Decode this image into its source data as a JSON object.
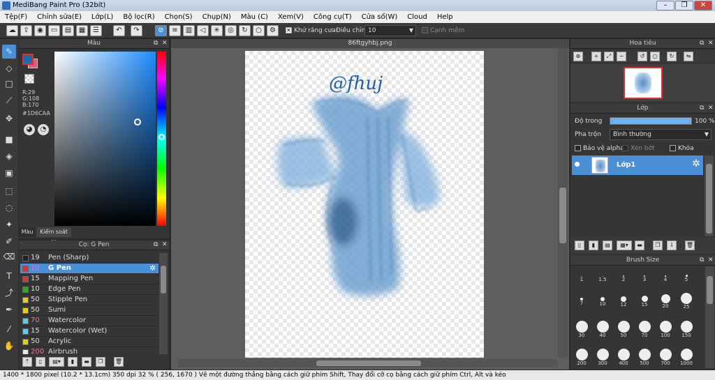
{
  "window": {
    "title": "MediBang Paint Pro (32bit)"
  },
  "menu": [
    "Tệp(F)",
    "Chỉnh sửa(E)",
    "Lớp(L)",
    "Bộ lọc(R)",
    "Chọn(S)",
    "Chụp(N)",
    "Màu (C)",
    "Xem(V)",
    "Công cụ(T)",
    "Cửa sổ(W)",
    "Cloud",
    "Help"
  ],
  "toolbar": {
    "antialias_label": "Khử răng cưa",
    "correction_label": "Điều chỉnh",
    "correction_value": "10",
    "soft_edge_label": "Cạnh mềm"
  },
  "color_panel": {
    "title": "Màu",
    "r": "R:29",
    "g": "G:108",
    "b": "B:170",
    "hex": "#1D6CAA",
    "tab_color": "Màu",
    "tab_brush_control": "Kiểm soát cọ",
    "fg_color": "#1D6CAA",
    "bg_color": "#e05a7a"
  },
  "brush_panel": {
    "title": "Cọ: G Pen",
    "items": [
      {
        "size": "19",
        "name": "Pen (Sharp)",
        "color": "#222222"
      },
      {
        "size": "10",
        "name": "G Pen",
        "color": "#e03030"
      },
      {
        "size": "15",
        "name": "Mapping Pen",
        "color": "#e03030"
      },
      {
        "size": "10",
        "name": "Edge Pen",
        "color": "#20b020"
      },
      {
        "size": "50",
        "name": "Stipple Pen",
        "color": "#e8d000"
      },
      {
        "size": "50",
        "name": "Sumi",
        "color": "#e8d000"
      },
      {
        "size": "70",
        "name": "Watercolor",
        "color": "#60c8f0"
      },
      {
        "size": "15",
        "name": "Watercolor (Wet)",
        "color": "#60c8f0"
      },
      {
        "size": "50",
        "name": "Acrylic",
        "color": "#e8d000"
      },
      {
        "size": "200",
        "name": "Airbrush",
        "color": "#e8e8e8"
      }
    ]
  },
  "canvas": {
    "filename": "86ftgyhbj.png",
    "signature": "@fhuj"
  },
  "navigator": {
    "title": "Hoa tiêu"
  },
  "layer_panel": {
    "title": "Lớp",
    "opacity_label": "Độ trong",
    "opacity_value": "100 %",
    "opacity_fraction": 1.0,
    "blend_label": "Pha trộn",
    "blend_value": "Bình thường",
    "protect_alpha": "Bảo vệ alpha",
    "clipping": "Xén bớt",
    "lock": "Khóa",
    "layer_name": "Lớp1"
  },
  "brush_size_panel": {
    "title": "Brush Size",
    "sizes": [
      "1",
      "1.5",
      "2",
      "3",
      "4",
      "5",
      "7",
      "10",
      "12",
      "15",
      "20",
      "25",
      "30",
      "40",
      "50",
      "70",
      "100",
      "150",
      "200",
      "300",
      "400",
      "500",
      "700",
      "1000"
    ]
  },
  "status": {
    "text": "1400 * 1800 pixel   (10.2 * 13.1cm)   350 dpi   32 %   ( 256, 1670 )   Vẽ một đường thẳng bằng cách giữ phím Shift, Thay đổi cỡ cọ bằng cách giữ phím Ctrl, Alt và kéo"
  }
}
